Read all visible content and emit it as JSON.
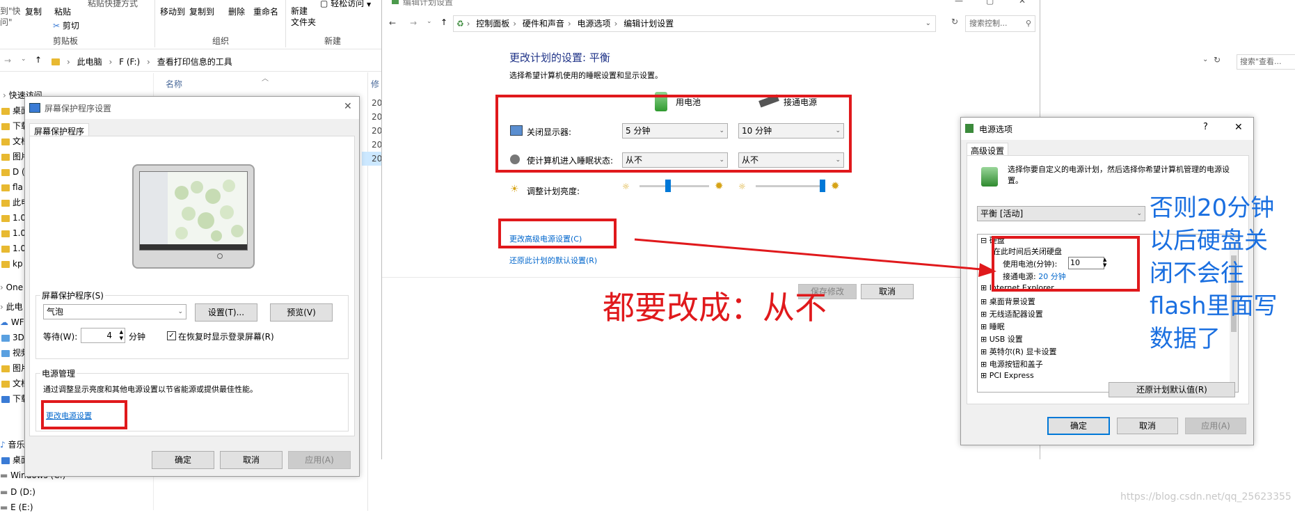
{
  "ribbon": {
    "left_partial": [
      "到\"快",
      "问\""
    ],
    "copy": "复制",
    "paste": "粘贴",
    "paste_shortcut": "粘贴快捷方式",
    "cut": "剪切",
    "move_to": "移动到",
    "copy_to": "复制到",
    "delete": "删除",
    "rename": "重命名",
    "new_folder": "新建\n文件夹",
    "easy_access": "轻松访问",
    "group_clipboard": "剪贴板",
    "group_organize": "组织",
    "group_new": "新建"
  },
  "explorer": {
    "breadcrumb": [
      "此电脑",
      "F (F:)",
      "查看打印信息的工具"
    ],
    "column_name": "名称",
    "column_modified": "修",
    "search_placeholder": "搜索\"查看...",
    "date_rows": [
      "20",
      "20",
      "20",
      "20",
      "20"
    ],
    "nav": [
      "快速访问",
      "桌面",
      "下载",
      "文档",
      "图片",
      "D (",
      "fla",
      "此电",
      "1.0",
      "1.0",
      "1.0",
      "kp",
      "One",
      "此电",
      "WF",
      "3D",
      "视频",
      "图片",
      "文档",
      "下载",
      "音乐",
      "桌面",
      "Windows (C:)",
      "D (D:)",
      "E (E:)"
    ]
  },
  "screensaver": {
    "title": "屏幕保护程序设置",
    "tab": "屏幕保护程序",
    "group_label": "屏幕保护程序(S)",
    "selected": "气泡",
    "settings_btn": "设置(T)...",
    "preview_btn": "预览(V)",
    "wait_label": "等待(W):",
    "wait_value": "4",
    "wait_unit": "分钟",
    "resume_label": "在恢复时显示登录屏幕(R)",
    "power_group": "电源管理",
    "power_desc": "通过调整显示亮度和其他电源设置以节省能源或提供最佳性能。",
    "power_link": "更改电源设置",
    "ok": "确定",
    "cancel": "取消",
    "apply": "应用(A)"
  },
  "edit_plan": {
    "window_title": "编辑计划设置",
    "breadcrumb": [
      "控制面板",
      "硬件和声音",
      "电源选项",
      "编辑计划设置"
    ],
    "search_placeholder": "搜索控制...",
    "heading": "更改计划的设置: 平衡",
    "subheading": "选择希望计算机使用的睡眠设置和显示设置。",
    "on_battery": "用电池",
    "plugged_in": "接通电源",
    "display_off_label": "关闭显示器:",
    "display_off_battery": "5 分钟",
    "display_off_plugged": "10 分钟",
    "sleep_label": "使计算机进入睡眠状态:",
    "sleep_battery": "从不",
    "sleep_plugged": "从不",
    "brightness_label": "调整计划亮度:",
    "brightness_battery_level": 0.4,
    "brightness_plugged_level": 1.0,
    "advanced_link": "更改高级电源设置(C)",
    "restore_link": "还原此计划的默认设置(R)",
    "save": "保存修改",
    "cancel": "取消"
  },
  "power_options": {
    "title": "电源选项",
    "help": "?",
    "close": "✕",
    "tab": "高级设置",
    "desc": "选择你要自定义的电源计划，然后选择你希望计算机管理的电源设置。",
    "plan_selected": "平衡 [活动]",
    "tree": {
      "hdd": "硬盘",
      "hdd_child": "在此时间后关闭硬盘",
      "battery_label": "使用电池(分钟):",
      "battery_value": "10",
      "plugged_label": "接通电源:",
      "plugged_value": "20 分钟",
      "items": [
        "Internet Explorer",
        "桌面背景设置",
        "无线适配器设置",
        "睡眠",
        "USB 设置",
        "英特尔(R) 显卡设置",
        "电源按钮和盖子",
        "PCI Express"
      ]
    },
    "restore_btn": "还原计划默认值(R)",
    "ok": "确定",
    "cancel": "取消",
    "apply": "应用(A)"
  },
  "annotations": {
    "main": "都要改成：从不",
    "side": [
      "否则20分钟",
      "以后硬盘关",
      "闭不会往",
      "flash里面写",
      "数据了"
    ],
    "accent_red": "#e0191c",
    "accent_blue": "#1a6fe0"
  },
  "watermark": "https://blog.csdn.net/qq_25623355"
}
